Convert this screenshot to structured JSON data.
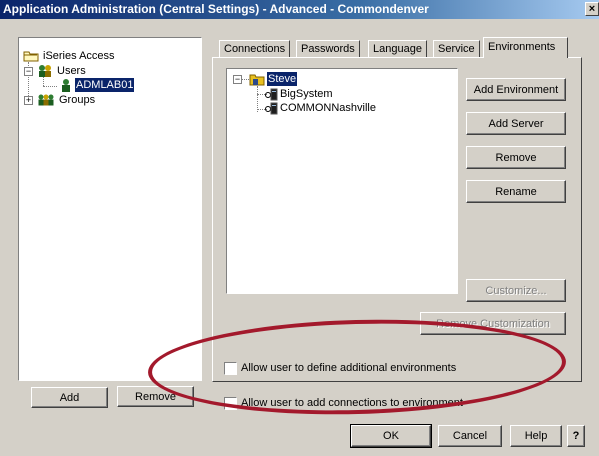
{
  "window": {
    "title": "Application Administration (Central Settings) - Advanced - Commondenver",
    "close_glyph": "×"
  },
  "left_tree": {
    "root": "iSeries Access",
    "users": "Users",
    "user_selected": "ADMLAB01",
    "groups": "Groups"
  },
  "left_buttons": {
    "add": "Add",
    "remove": "Remove"
  },
  "tabs": [
    {
      "label": "Connections",
      "active": false
    },
    {
      "label": "Passwords",
      "active": false
    },
    {
      "label": "Language",
      "active": false
    },
    {
      "label": "Service",
      "active": false
    },
    {
      "label": "Environments",
      "active": true
    }
  ],
  "env_tree": {
    "root": "Steve",
    "children": [
      "BigSystem",
      "COMMONNashville"
    ]
  },
  "env_buttons": {
    "add_environment": "Add Environment",
    "add_server": "Add Server",
    "remove": "Remove",
    "rename": "Rename",
    "customize": "Customize...",
    "remove_customization": "Remove Customization"
  },
  "checkboxes": {
    "define_envs": {
      "label": "Allow user to define additional environments",
      "checked": false
    },
    "add_connections": {
      "label": "Allow user to add connections to environment",
      "checked": false
    }
  },
  "bottom_buttons": {
    "ok": "OK",
    "cancel": "Cancel",
    "help": "Help",
    "whats_this": "?"
  },
  "colors": {
    "selection": "#0a246a",
    "dialog_bg": "#d4d0c8",
    "annotation": "#a3192c",
    "title_gradient_start": "#0a246a"
  },
  "icons": {
    "root_folder": "folder-icon",
    "users": "users-group-icon",
    "user": "user-icon",
    "groups": "groups-icon",
    "environment": "environment-folder-icon",
    "server": "server-icon"
  }
}
